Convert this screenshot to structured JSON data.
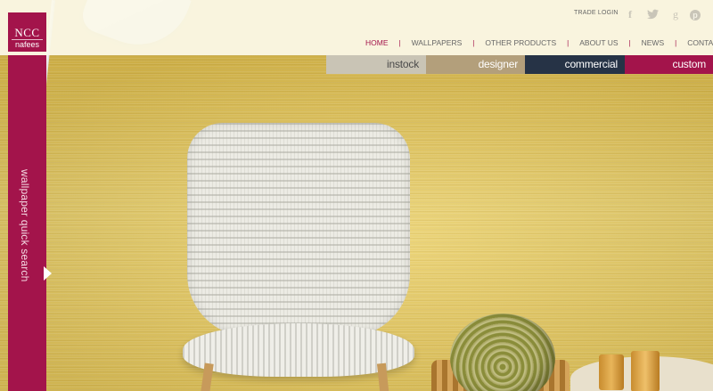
{
  "logo": {
    "top": "NCC",
    "bottom": "nafees"
  },
  "header": {
    "trade_login": "TRADE LOGIN"
  },
  "social": [
    {
      "name": "facebook-icon",
      "glyph": "f"
    },
    {
      "name": "twitter-icon",
      "glyph": "🐦"
    },
    {
      "name": "google-plus-icon",
      "glyph": "g"
    },
    {
      "name": "pinterest-icon",
      "glyph": "p"
    }
  ],
  "nav": {
    "items": [
      "HOME",
      "WALLPAPERS",
      "OTHER PRODUCTS",
      "ABOUT US",
      "NEWS",
      "CONTACT"
    ],
    "separator": "|",
    "active": "HOME",
    "active_color": "#a3144b"
  },
  "categories": [
    "instock",
    "designer",
    "commercial",
    "custom"
  ],
  "quick_search": {
    "label": "wallpaper quick search"
  },
  "colors": {
    "brand": "#a3144b",
    "instock": "#c9c4b5",
    "designer": "#b39f7b",
    "commercial": "#263346",
    "custom": "#a3144b"
  }
}
